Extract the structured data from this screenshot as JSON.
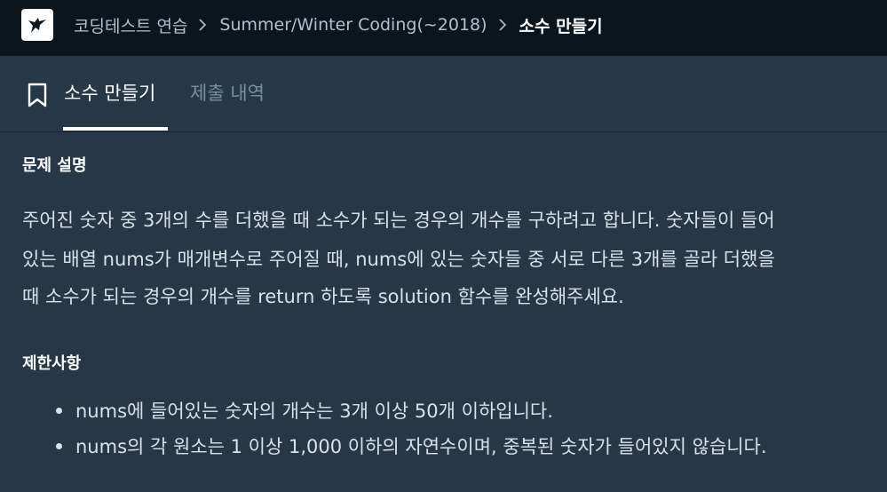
{
  "breadcrumb": {
    "items": [
      "코딩테스트 연습",
      "Summer/Winter Coding(~2018)",
      "소수 만들기"
    ]
  },
  "tabs": {
    "active": "소수 만들기",
    "submissions": "제출 내역"
  },
  "description": {
    "title": "문제 설명",
    "line1": "주어진 숫자 중 3개의 수를 더했을 때 소수가 되는 경우의 개수를 구하려고 합니다. 숫자들이 들어",
    "line2": "있는 배열 nums가 매개변수로 주어질 때, nums에 있는 숫자들 중 서로 다른 3개를 골라 더했을",
    "line3": "때 소수가 되는 경우의 개수를 return 하도록 solution 함수를 완성해주세요."
  },
  "constraints": {
    "title": "제한사항",
    "items": [
      "nums에 들어있는 숫자의 개수는 3개 이상 50개 이하입니다.",
      "nums의 각 원소는 1 이상 1,000 이하의 자연수이며, 중복된 숫자가 들어있지 않습니다."
    ]
  },
  "colors": {
    "topbar": "#0c151c",
    "background": "#263747",
    "text": "#d7e2eb",
    "muted": "#78909c"
  },
  "icons": {
    "logo": "hummingbird-logo-icon",
    "separator": "chevron-right-icon",
    "bookmark": "bookmark-icon"
  }
}
